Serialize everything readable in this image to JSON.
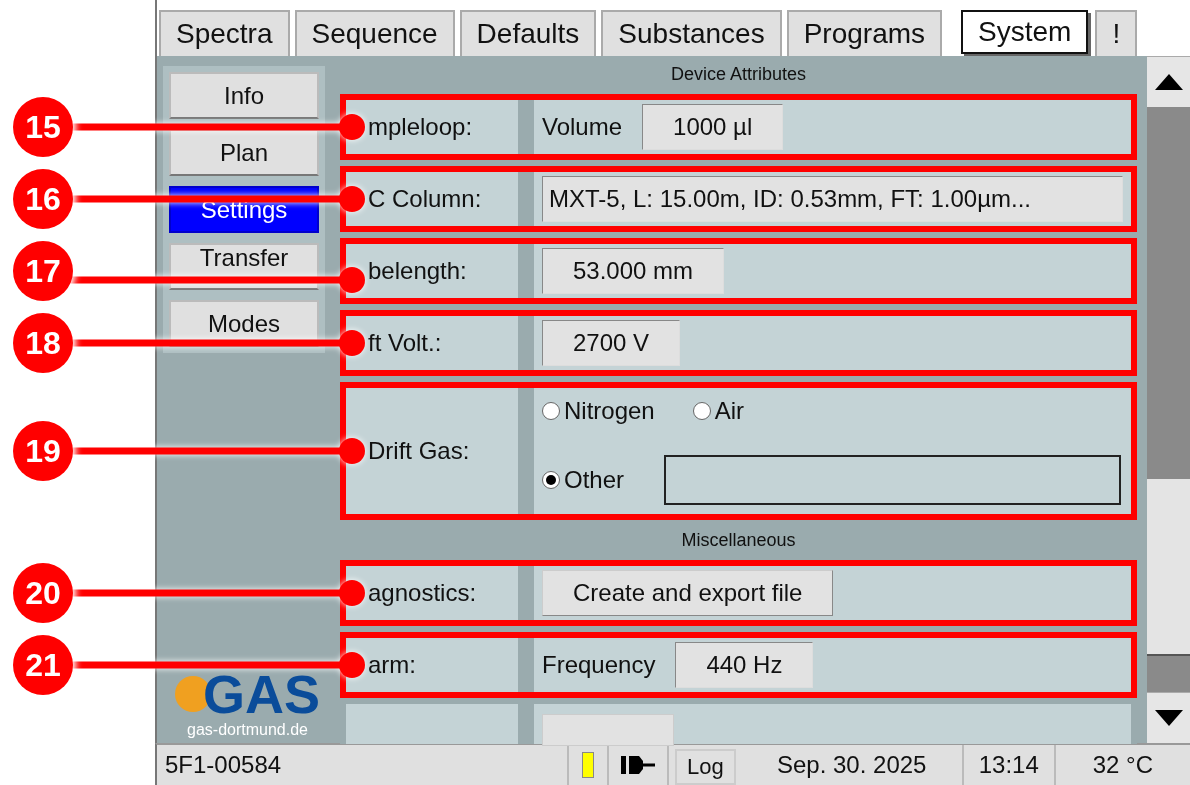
{
  "tabs": [
    {
      "label": "Spectra",
      "selected": false
    },
    {
      "label": "Sequence",
      "selected": false
    },
    {
      "label": "Defaults",
      "selected": false
    },
    {
      "label": "Substances",
      "selected": false
    },
    {
      "label": "Programs",
      "selected": false
    },
    {
      "label": "System",
      "selected": true
    },
    {
      "label": "!",
      "selected": false
    }
  ],
  "sidebar": {
    "items": [
      {
        "label": "Info",
        "selected": false
      },
      {
        "label": "Plan",
        "selected": false
      },
      {
        "label": "Settings",
        "selected": true
      },
      {
        "label": "Transfer",
        "selected": false
      },
      {
        "label": "Modes",
        "selected": false
      }
    ],
    "logo": {
      "text": "GAS",
      "url": "gas-dortmund.de"
    }
  },
  "sections": [
    {
      "title": "Device Attributes",
      "rows": [
        {
          "callout": "15",
          "label": "mpleloop:",
          "kind": "labeled_value",
          "prefix": "Volume",
          "value": "1000 µl"
        },
        {
          "callout": "16",
          "label": "C Column:",
          "kind": "long_value",
          "value": "MXT-5, L: 15.00m, ID: 0.53mm, FT: 1.00µm..."
        },
        {
          "callout": "17",
          "label": "belength:",
          "kind": "value",
          "value": "53.000 mm"
        },
        {
          "callout": "18",
          "label": "ft Volt.:",
          "kind": "value",
          "value": "2700 V"
        },
        {
          "callout": "19",
          "label": "Drift Gas:",
          "kind": "radio",
          "options": [
            {
              "label": "Nitrogen",
              "selected": false
            },
            {
              "label": "Air",
              "selected": false
            },
            {
              "label": "Other",
              "selected": true,
              "has_field": true
            }
          ]
        }
      ]
    },
    {
      "title": "Miscellaneous",
      "rows": [
        {
          "callout": "20",
          "label": "agnostics:",
          "kind": "button",
          "value": "Create and export file"
        },
        {
          "callout": "21",
          "label": "arm:",
          "kind": "labeled_value",
          "prefix": "Frequency",
          "value": "440 Hz"
        },
        {
          "kind": "stub"
        }
      ]
    }
  ],
  "status_bar": {
    "device_id": "5F1-00584",
    "log_button": "Log",
    "date": "Sep. 30. 2025",
    "time": "13:14",
    "temperature": "32 °C"
  }
}
